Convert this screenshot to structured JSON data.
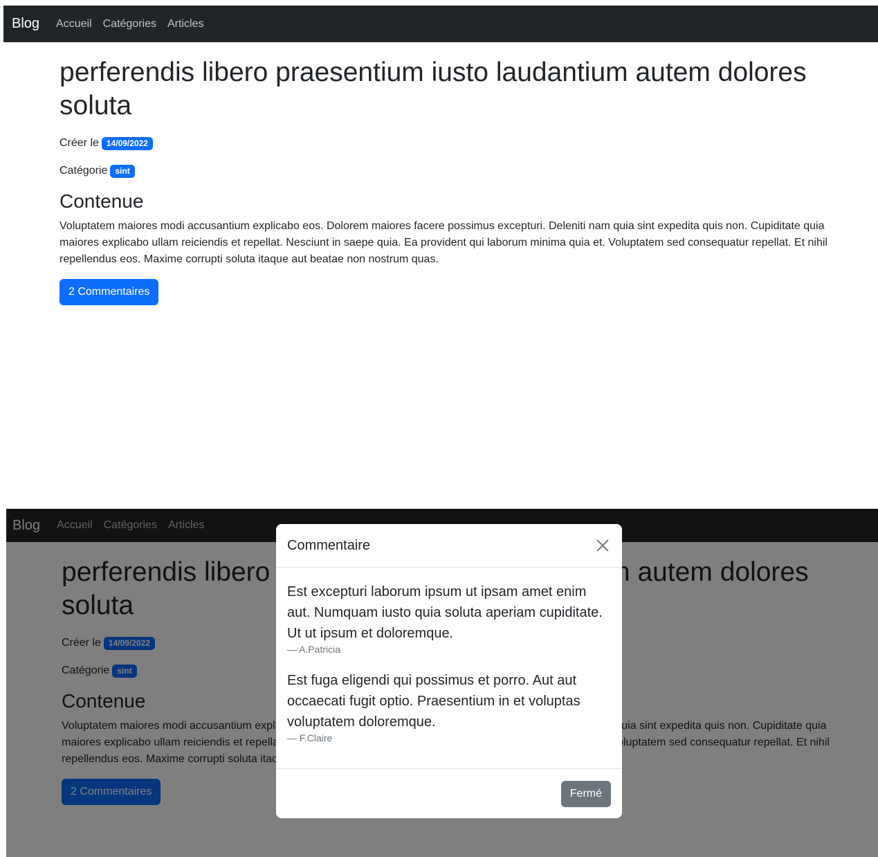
{
  "navbar": {
    "brand": "Blog",
    "links": [
      "Accueil",
      "Catégories",
      "Articles"
    ]
  },
  "article": {
    "title": "perferendis libero praesentium iusto laudantium autem dolores soluta",
    "created_label": "Créer le",
    "created_date": "14/09/2022",
    "category_label": "Catégorie",
    "category": "sint",
    "content_heading": "Contenue",
    "content": "Voluptatem maiores modi accusantium explicabo eos. Dolorem maiores facere possimus excepturi. Deleniti nam quia sint expedita quis non. Cupiditate quia maiores explicabo ullam reiciendis et repellat. Nesciunt in saepe quia. Ea provident qui laborum minima quia et. Voluptatem sed consequatur repellat. Et nihil repellendus eos. Maxime corrupti soluta itaque aut beatae non nostrum quas.",
    "comments_button": "2 Commentaires"
  },
  "modal": {
    "title": "Commentaire",
    "comments": [
      {
        "text": "Est excepturi laborum ipsum ut ipsam amet enim aut. Numquam iusto quia soluta aperiam cupiditate. Ut ut ipsum et doloremque.",
        "author": "— A.Patricia"
      },
      {
        "text": "Est fuga eligendi qui possimus et porro. Aut aut occaecati fugit optio. Praesentium in et voluptas voluptatem doloremque.",
        "author": "— F.Claire"
      }
    ],
    "close_button": "Fermé"
  },
  "colors": {
    "navbar_bg": "#212529",
    "primary": "#0d6efd",
    "secondary": "#6c757d"
  }
}
